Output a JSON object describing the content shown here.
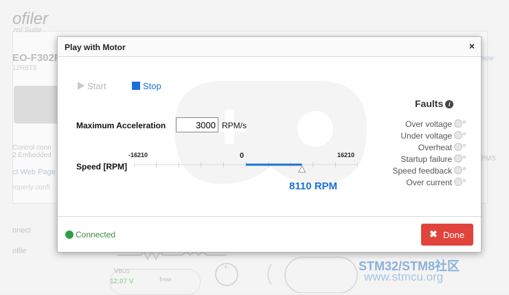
{
  "background": {
    "brand": "ofiler",
    "brand_sub": "rol Suite",
    "board_title": "EO-F302F",
    "board_sub": "12R8T6",
    "desc_line1": "Control conn",
    "desc_line2": "2 Embedded",
    "link": "ct Web Page",
    "link2": "roperly confi",
    "right_link": "how",
    "right_text": "PMS",
    "nav_connect": "nnect",
    "nav_profile": "ofile",
    "vbus_label": "V",
    "vbus_sub": "BUS",
    "vbus_value": "12.07 V",
    "imax_label": "I",
    "imax_sub": "max",
    "watermark_line1": "STM32/STM8社区",
    "watermark_line2": "www.stmcu.org"
  },
  "modal": {
    "title": "Play with Motor",
    "close": "×",
    "start_label": "Start",
    "stop_label": "Stop",
    "max_accel_label": "Maximum Acceleration",
    "max_accel_value": "3000",
    "max_accel_unit": "RPM/s",
    "speed_label": "Speed [RPM]",
    "speed_min": "-16210",
    "speed_zero": "0",
    "speed_max": "16210",
    "speed_range": [
      -16210,
      16210
    ],
    "speed_setpoint": 8110,
    "speed_value_text": "8110 RPM",
    "faults_title": "Faults",
    "faults_info_icon": "i",
    "faults": [
      {
        "label": "Over voltage"
      },
      {
        "label": "Under voltage"
      },
      {
        "label": "Overheat"
      },
      {
        "label": "Startup failure"
      },
      {
        "label": "Speed feedback"
      },
      {
        "label": "Over current"
      }
    ],
    "status_text": "Connected",
    "done_label": "Done",
    "done_icon": "✖"
  },
  "colors": {
    "accent": "#1b6fd8",
    "done": "#e0443a",
    "connected": "#2aa043"
  }
}
